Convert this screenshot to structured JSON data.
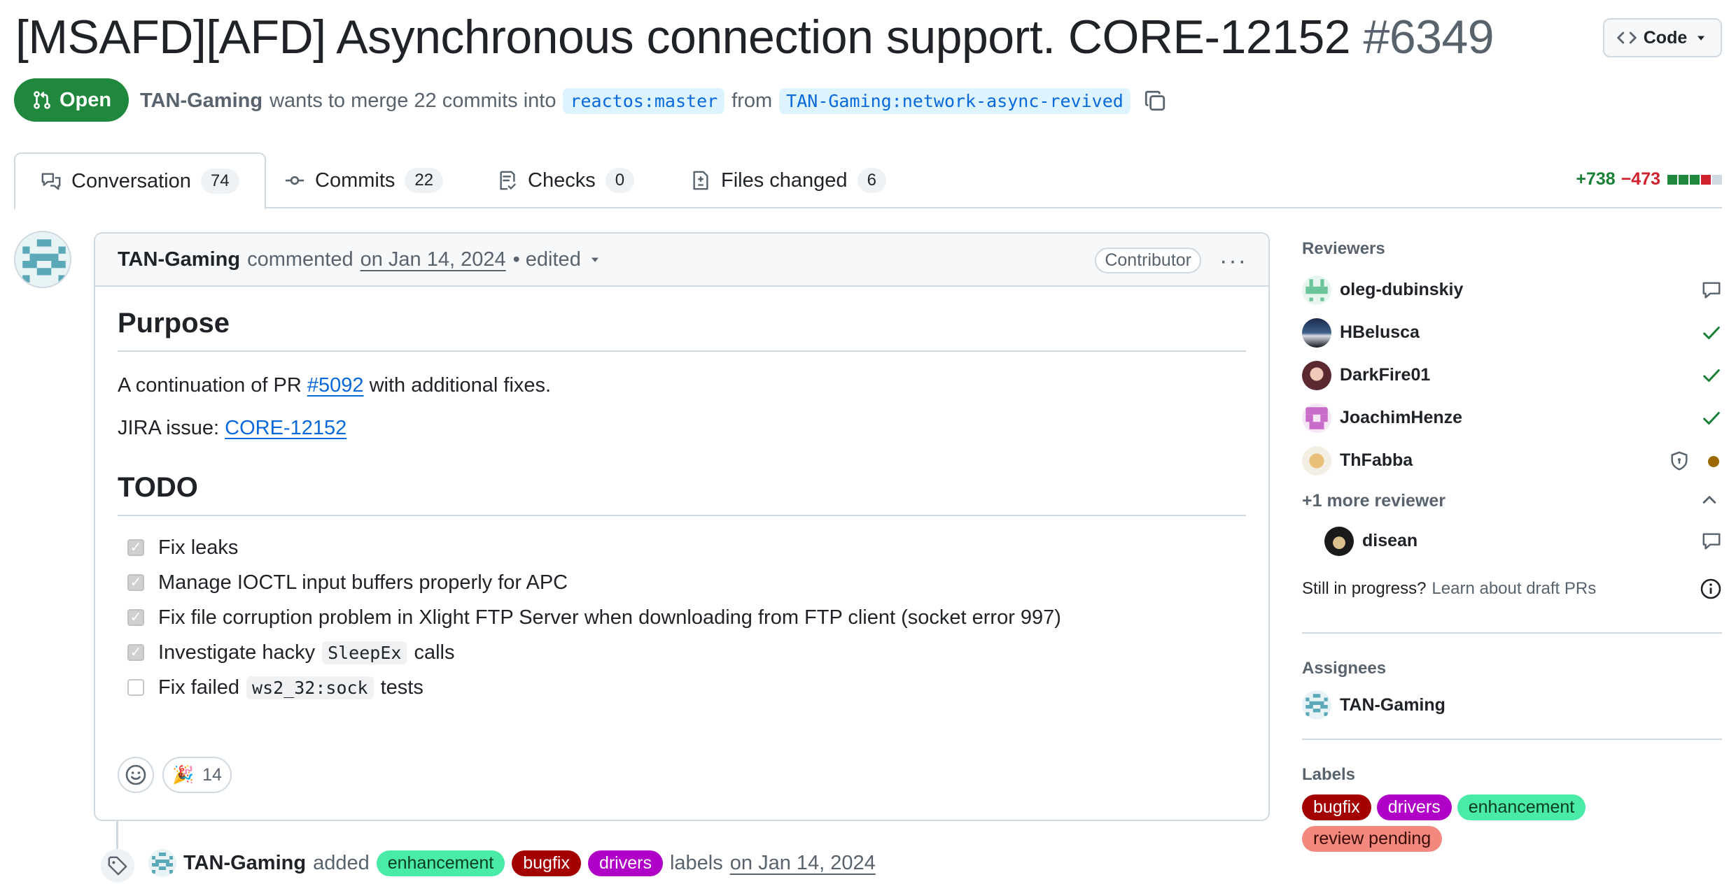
{
  "pr": {
    "title": "[MSAFD][AFD] Asynchronous connection support. CORE-12152",
    "number": "#6349",
    "state": "Open",
    "author": "TAN-Gaming",
    "merge_text": "wants to merge 22 commits into",
    "base_branch": "reactos:master",
    "from_text": "from",
    "head_branch": "TAN-Gaming:network-async-revived"
  },
  "code_button": {
    "label": "Code"
  },
  "tabs": [
    {
      "label": "Conversation",
      "count": "74"
    },
    {
      "label": "Commits",
      "count": "22"
    },
    {
      "label": "Checks",
      "count": "0"
    },
    {
      "label": "Files changed",
      "count": "6"
    }
  ],
  "diffstat": {
    "additions": "+738",
    "deletions": "−473"
  },
  "comment": {
    "author": "TAN-Gaming",
    "action": "commented",
    "date": "on Jan 14, 2024",
    "edited": "• edited",
    "role_badge": "Contributor",
    "purpose_heading": "Purpose",
    "continuation_pre": "A continuation of PR",
    "continuation_link": "#5092",
    "continuation_post": "with additional fixes.",
    "jira_pre": "JIRA issue:",
    "jira_link": "CORE-12152",
    "todo_heading": "TODO",
    "todos": [
      {
        "text": "Fix leaks",
        "checked": true
      },
      {
        "text": "Manage IOCTL input buffers properly for APC",
        "checked": true
      },
      {
        "text": "Fix file corruption problem in Xlight FTP Server when downloading from FTP client (socket error 997)",
        "checked": true
      },
      {
        "pre": "Investigate hacky",
        "code": "SleepEx",
        "post": "calls",
        "checked": true
      },
      {
        "pre": "Fix failed",
        "code": "ws2_32:sock",
        "post": "tests",
        "checked": false
      }
    ],
    "reaction_emoji": "🎉",
    "reaction_count": "14"
  },
  "timeline_event": {
    "author": "TAN-Gaming",
    "action": "added",
    "labels": [
      "enhancement",
      "bugfix",
      "drivers"
    ],
    "suffix": "labels",
    "date": "on Jan 14, 2024"
  },
  "sidebar": {
    "reviewers_heading": "Reviewers",
    "reviewers": [
      {
        "name": "oleg-dubinskiy",
        "status": "comment-icon"
      },
      {
        "name": "HBelusca",
        "status": "check-icon"
      },
      {
        "name": "DarkFire01",
        "status": "check-icon"
      },
      {
        "name": "JoachimHenze",
        "status": "check-icon"
      },
      {
        "name": "ThFabba",
        "status": "pending-dot"
      }
    ],
    "more_reviewers": "+1 more reviewer",
    "extra_reviewer": "disean",
    "draft_question": "Still in progress?",
    "draft_link": "Learn about draft PRs",
    "assignees_heading": "Assignees",
    "assignee": "TAN-Gaming",
    "labels_heading": "Labels",
    "labels": [
      "bugfix",
      "drivers",
      "enhancement",
      "review pending"
    ]
  },
  "colors": {
    "open_green": "#1f883d",
    "link_blue": "#0969da",
    "label_enhancement": "#4aeba6",
    "label_bugfix": "#a30000",
    "label_drivers": "#b000c8",
    "label_review_pending": "#f3887e"
  }
}
